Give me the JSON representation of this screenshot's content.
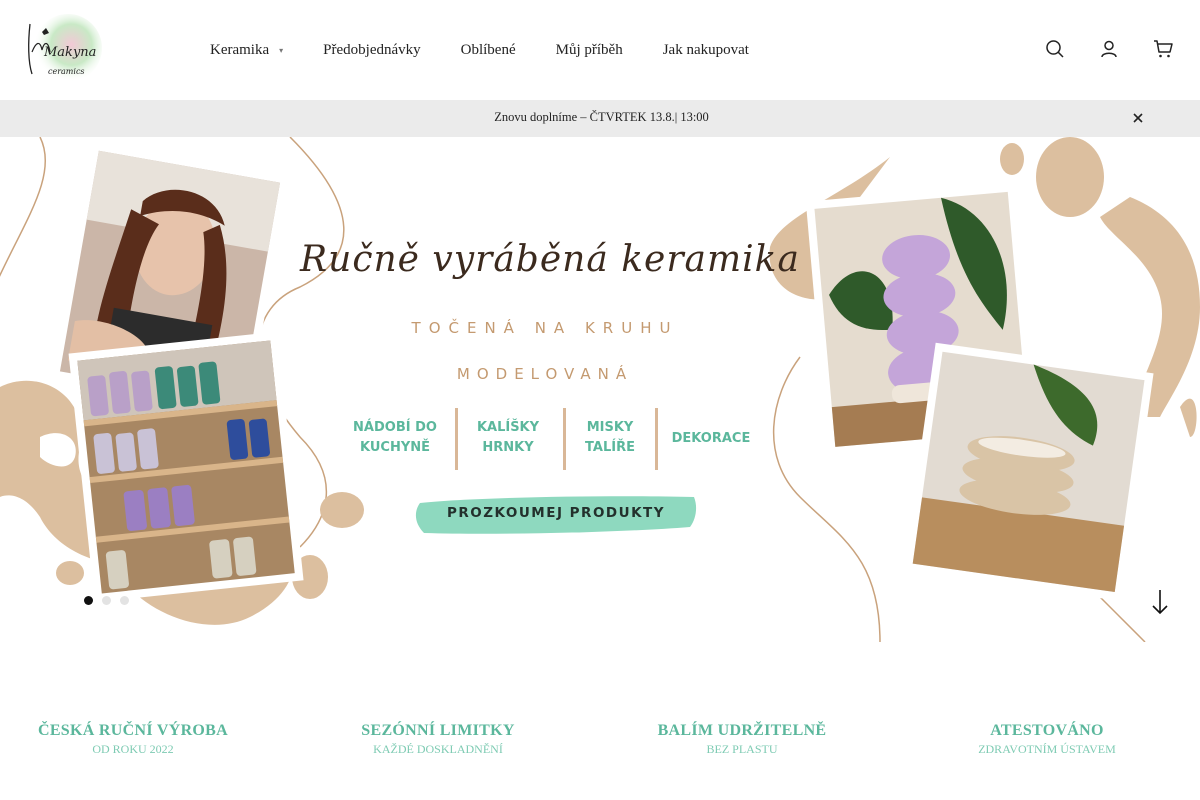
{
  "brand": {
    "logo_text_1": "Makyna",
    "logo_text_2": "ceramics"
  },
  "nav": {
    "items": [
      {
        "label": "Keramika",
        "has_dropdown": true
      },
      {
        "label": "Předobjednávky"
      },
      {
        "label": "Oblíbené"
      },
      {
        "label": "Můj příběh"
      },
      {
        "label": "Jak nakupovat"
      }
    ],
    "icons": [
      "search-icon",
      "user-icon",
      "cart-icon"
    ]
  },
  "announcement": {
    "icon": "",
    "text": "Znovu doplníme – ČTVRTEK 13.8.| 13:00"
  },
  "hero": {
    "title": "Ručně vyráběná keramika",
    "subtitle_1": "TOČENÁ NA KRUHU",
    "subtitle_2": "MODELOVANÁ",
    "categories": [
      {
        "line1": "NÁDOBÍ DO",
        "line2": "KUCHYNĚ"
      },
      {
        "line1": "KALÍŠKY",
        "line2": "HRNKY"
      },
      {
        "line1": "MISKY",
        "line2": "TALÍŘE"
      },
      {
        "line1": "DEKORACE",
        "line2": ""
      }
    ],
    "cta_label": "PROZKOUMEJ PRODUKTY",
    "slides_total": 3,
    "slide_active": 1
  },
  "features": [
    {
      "icon": "",
      "title": "ČESKÁ RUČNÍ VÝROBA",
      "subtitle": "OD ROKU 2022"
    },
    {
      "icon": "",
      "title": "SEZÓNNÍ LIMITKY",
      "subtitle": "KAŽDÉ DOSKLADNĚNÍ"
    },
    {
      "icon": "",
      "title": "BALÍM UDRŽITELNĚ",
      "subtitle": "BEZ PLASTU"
    },
    {
      "icon": "",
      "title": "ATESTOVÁNO",
      "subtitle": "ZDRAVOTNÍM ÚSTAVEM"
    }
  ],
  "colors": {
    "accent": "#5bb79c",
    "accent_light": "#7ecbb3",
    "beige": "#d9b797",
    "announce_bg": "#ebebeb",
    "cta_bg": "#8ed9bf"
  }
}
